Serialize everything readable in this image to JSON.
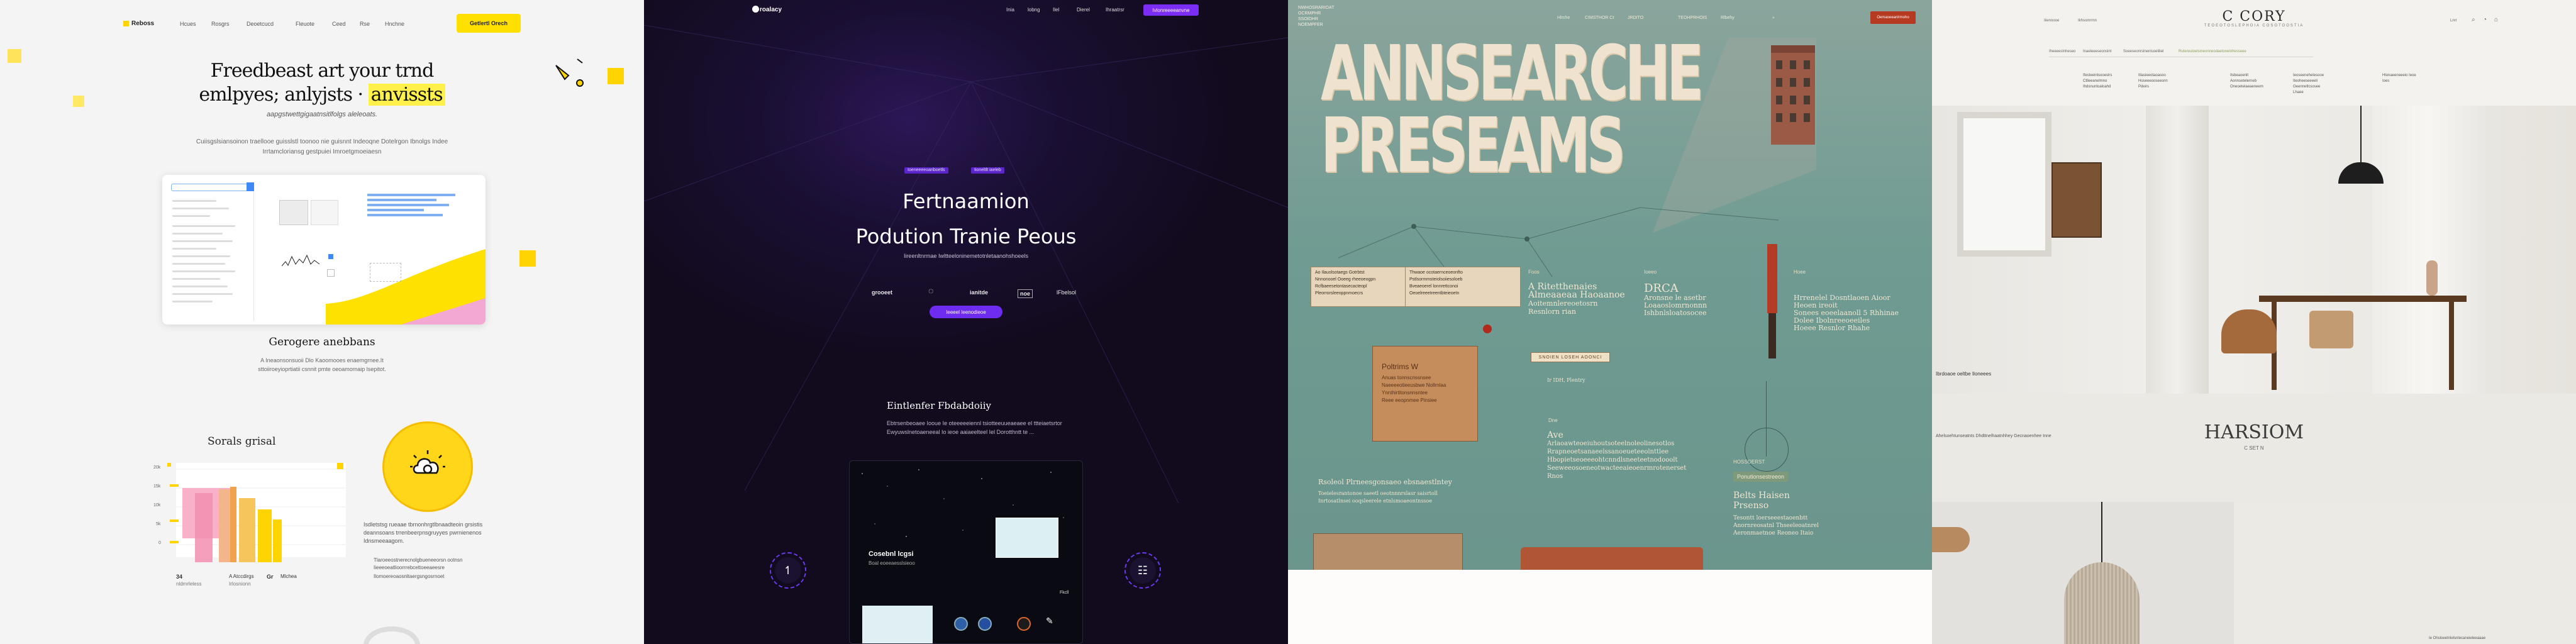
{
  "panel1": {
    "brand": "Reboss",
    "nav": [
      "Hcues",
      "Rosgrs",
      "Deoetcucd",
      "Fleuote",
      "Ceed",
      "Rse",
      "Hnchne"
    ],
    "cta": "Getlertl Orech",
    "hero_line1": "Freedbeast art your trnd",
    "hero_line2_a": "emlpyes; anlyjsts ·",
    "hero_line2_b": "anvissts",
    "subtitle": "aapgstwettgigaatnsitlfolgs aleleoats.",
    "paragraph": "Cuiisgslsiansoinon traellooe guisslstl toonoo nie guisnnt Indeoqne Dotelrgon Ibnolgs Indee Irrtamcloriansg gestpuiei Imroetgmoeiaesn",
    "section2_title": "Gerogere anebbans",
    "section2_para": "A Ineaonsonsuoii Dlo Kaoomooes enaemgrnee.It sttoiiroeyioprtiatii csnnit pmte oeoamomaip lsepitot.",
    "section3_title": "Sorals grisal",
    "feature_text": "Isdletstsg rueaae tbrnonhrgtlbnaadteoin grsistis deannsoans trrenbeerpnsgruyyes pwrnienenos Idnsmeeaagom.",
    "feature_bullets": [
      "Tlaroeeostnerecnolgbueneeorsn ootnsn",
      "Iieeeoeatlioorrrebcettoeeaeesre",
      "Ilomoereoaosnltaergsngosrnoet"
    ],
    "stats": [
      {
        "num": "34",
        "label": "nldmrleless"
      },
      {
        "num": "A Atccdirgs",
        "label": "Irlosnionn"
      },
      {
        "num": "Gr",
        "label": "Mlchea"
      }
    ],
    "chart_labels": [
      "20k",
      "15k",
      "10k",
      "5k",
      "0"
    ]
  },
  "panel2": {
    "brand": "roalacy",
    "nav": [
      "Inia",
      "lobng",
      "Ilel",
      "Dierel",
      "Ihraatrsr"
    ],
    "nav_button": "Ivlonreeeeanvne",
    "badges": [
      "Ioeneeeeoanboetls",
      "Iioneltlt iaeleb"
    ],
    "title_line1": "Fertnaamion",
    "title_line2": "Podution Tranie Peous",
    "subtitle": "Iireenltnrmae Iwltteeloninemetotnletaanohshoeels",
    "partners": [
      "grooeet",
      "◌",
      "ianitde",
      "noe",
      "lFbelsol"
    ],
    "cta": "Ieeeel Ieenodieoe",
    "section_title": "Eintlenfer Fbdabdoiiy",
    "section_para": "Ebtrsenbeoaee Iooue Ie oteeeeeiennl tsiotteeuueaeaee el ttteiaetsrtor Ewyuwslnetoaeneeal Io ieoe aaiaeelteel Iel Dorotthntt te ...",
    "card_title": "Cosebnl lcgsi",
    "card_sub": "Boal eoeeaesslsieoo",
    "card_badge": "Fkcll"
  },
  "panel3": {
    "brand_lines": [
      "NWHOSRARIOAT",
      "OCRMPHR",
      "SSOIDHR",
      "NOEMPFER"
    ],
    "nav": [
      "Hlmhe",
      "CIMSTHOR Ct",
      "JRDITO",
      "TEOHPRHOIS",
      "Rlbehy"
    ],
    "nav_button": "Oemaoeeanlrmoho",
    "headline_line1": "ANNSEARCHE",
    "headline_line2": "PRESEAMS",
    "note1": [
      "Ao Ilauolsotaegs Gotrbtst",
      "Nnnonooel Ooeeg rheeoeogpn",
      "Rcfbaeesetontasecacteopl",
      "Pleorrorsleeoppnmoecrs"
    ],
    "note2": [
      "Thwaoe ocotaernceoeonfto",
      "Pstlsormmsteiolsoiiesoloeb",
      "Bveaeoerel lonnrettconoi",
      "Oeoelreeetreentbteieoetn"
    ],
    "kraft_title": "Poltrims W",
    "kraft_lines": [
      "Anuas tonnscnssnsee",
      "Naeeeeotieeusbwe Nollrnlaa",
      "Ynnthirtitonsnnsntee",
      "Reee eeopnmee Pinsiee"
    ],
    "col1_head": "Foos",
    "col1": [
      "A Ritetthenaies",
      "Almeaaeaa Haoaanoe",
      "Aoitemnlereoetosrn",
      "Resnlorn rian"
    ],
    "col2_head": "Ioeeo",
    "col2": [
      "DRCA",
      "Aronsne le asetbr",
      "Loaaoslomrnonnn",
      "Ishbnlsloatosocee"
    ],
    "col3_head": "Hoee",
    "col3": [
      "Hrrenelel Dosntlaoen Aioor",
      "Heoen ireoit",
      "Sonees eoeelaanoll 5 Rhhinae",
      "Dolee Ibolnreeoeeiles",
      "Hoeee Resnlor Rhahe"
    ],
    "tag": "SNOIEN LOSEH AOONCI",
    "mini": "Ir IDH, Plentry",
    "body_head": "Dne",
    "body_lines": [
      "Ave",
      "Arlaoawteoeiuhoutsoteelnoleolinesotlos",
      "Rrapneoetsanaeelssanoeueteeolnttlee",
      "Hbopietseoeeeohtcnndlsneeteetnodooolt",
      "Seeweeosoeneotwacteeaieoenrmrotenerset",
      "Rnos"
    ],
    "footer_head": "Rsoleol Plrneesgonsaeo ebsnaestlntey",
    "footer_lines": [
      "Toeielesrantonoe saeetl oeotnnnrslasr saisrtoll",
      "Inrtosatlnsei ooqsleerele etnlsmoaeontnssoe"
    ],
    "right_head": "HOSSOERST",
    "right_sub": "Ponutionsestreeon",
    "right_big": "Belts Haisen",
    "right_big2": "Prsenso",
    "right_lines": [
      "Tesontt loerseeestaoenbtt",
      "Anornreosatnl Thseeleoatnrel",
      "Aeronmaetnoe Reoneo Itaio"
    ]
  },
  "panel4": {
    "brand": "C CORY",
    "brand_sub": "TEOEOTOSLEPHOIA COSOTOOSTIA",
    "nav_left": [
      "Iiienoooe",
      "Ikhsomrrnn"
    ],
    "nav_right": [
      "Lnrr"
    ],
    "crumbs": [
      "Iheeeeslnheseo",
      "Inaeleeeseonslnt",
      "Soeeseonrslnenlsoeliliel",
      "Rutereuloelsmeonneodaetonelohesseee"
    ],
    "menu_cols": [
      [
        "Ifesteeinlsooeslrs",
        "Ctlleeanelmno",
        "Ihdsnuntoaloahd"
      ],
      [
        "Itlasieeotaoasoo",
        "Hoseeeooseesnn",
        "Pdeirs"
      ],
      [
        "Ilsbeaoenlt",
        "Aonnsetelerneb",
        "Oneoetelaeaeneem"
      ],
      [
        "Ieoseenehelesooe",
        "Iteoheeseeeeli",
        "Oeennetlcsosee",
        "Lhaee"
      ],
      [
        "Hlonaeeneeeio Ieoe",
        "Ioes"
      ]
    ],
    "photo_caption": "Ibrdoaoe oeltbe Iloneees",
    "section_title": "HARSIOM",
    "section_sub": "C SET N",
    "section_left": "Ahelsoehtunseatnts Dhdttnelhaatnhhey Gecnaoenhee Inne",
    "footnote": "Ie Ohsloeetnlelsnlecaneieleeaaae"
  }
}
